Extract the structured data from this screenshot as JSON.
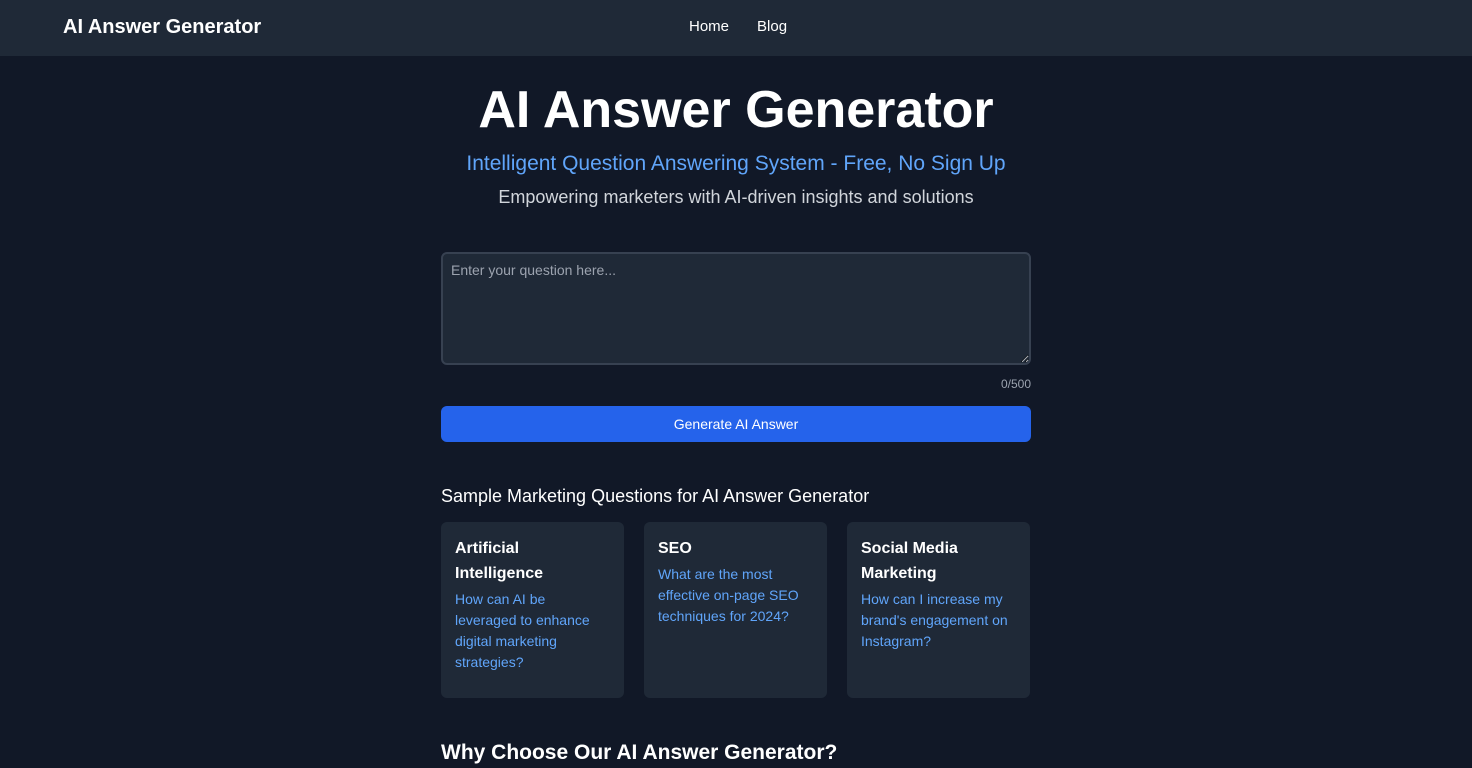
{
  "header": {
    "brand": "AI Answer Generator",
    "nav": [
      {
        "label": "Home"
      },
      {
        "label": "Blog"
      }
    ]
  },
  "hero": {
    "title": "AI Answer Generator",
    "subtitle": "Intelligent Question Answering System - Free, No Sign Up",
    "tagline": "Empowering marketers with AI-driven insights and solutions"
  },
  "form": {
    "placeholder": "Enter your question here...",
    "value": "",
    "counter": "0/500",
    "button_label": "Generate AI Answer"
  },
  "samples": {
    "heading": "Sample Marketing Questions for AI Answer Generator",
    "cards": [
      {
        "title": "Artificial Intelligence",
        "question": "How can AI be leveraged to enhance digital marketing strategies?"
      },
      {
        "title": "SEO",
        "question": "What are the most effective on-page SEO techniques for 2024?"
      },
      {
        "title": "Social Media Marketing",
        "question": "How can I increase my brand's engagement on Instagram?"
      }
    ]
  },
  "why": {
    "heading": "Why Choose Our AI Answer Generator?"
  },
  "colors": {
    "background": "#111827",
    "surface": "#1f2937",
    "accent": "#60a5fa",
    "button": "#2563eb"
  }
}
